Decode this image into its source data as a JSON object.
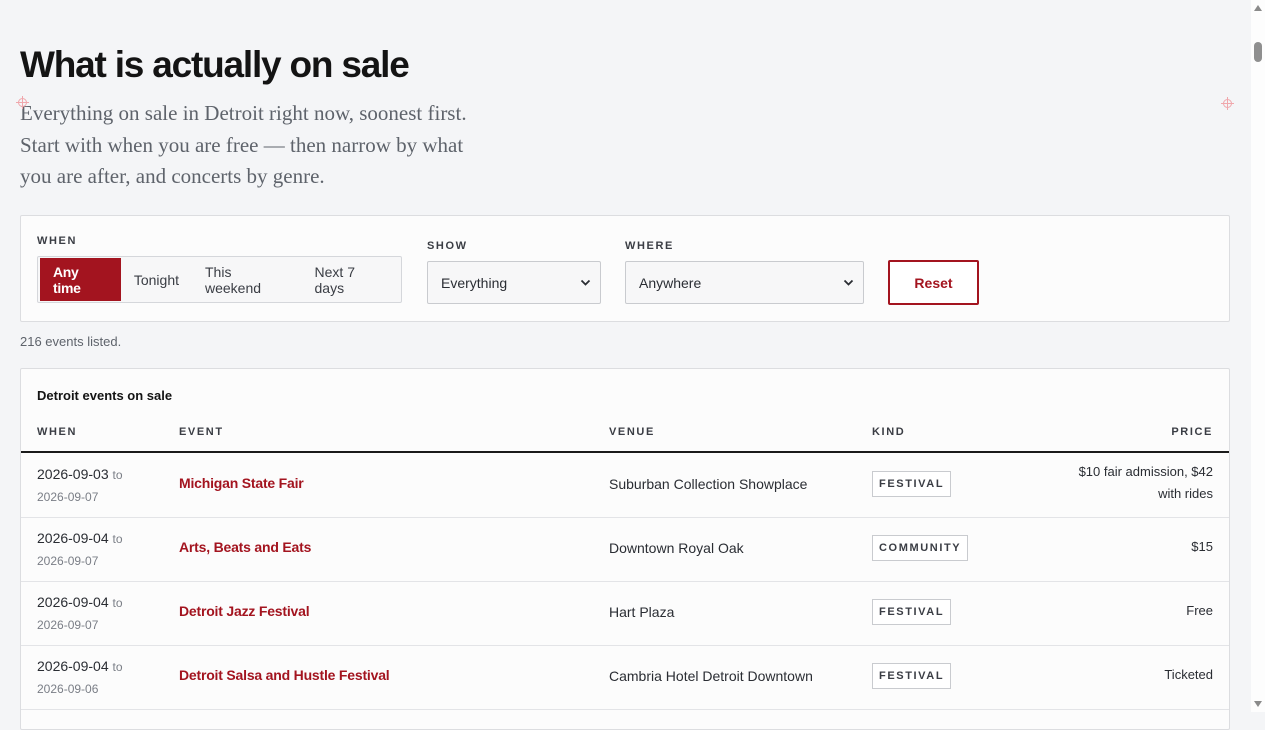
{
  "header": {
    "title": "What is actually on sale",
    "lede": "Everything on sale in Detroit right now, soonest first. Start with when you are free — then narrow by what you are after, and concerts by genre."
  },
  "filters": {
    "when_label": "WHEN",
    "when_options": [
      "Any time",
      "Tonight",
      "This weekend",
      "Next 7 days"
    ],
    "when_selected": "Any time",
    "show_label": "SHOW",
    "show_value": "Everything",
    "where_label": "WHERE",
    "where_value": "Anywhere",
    "reset_label": "Reset"
  },
  "count_text": "216 events listed.",
  "table": {
    "caption": "Detroit events on sale",
    "columns": [
      "WHEN",
      "EVENT",
      "VENUE",
      "KIND",
      "PRICE"
    ],
    "rows": [
      {
        "start": "2026-09-03",
        "to": "to",
        "end": "2026-09-07",
        "event": "Michigan State Fair",
        "venue": "Suburban Collection Showplace",
        "kind": "FESTIVAL",
        "price": "$10 fair admission, $42 with rides"
      },
      {
        "start": "2026-09-04",
        "to": "to",
        "end": "2026-09-07",
        "event": "Arts, Beats and Eats",
        "venue": "Downtown Royal Oak",
        "kind": "COMMUNITY",
        "price": "$15"
      },
      {
        "start": "2026-09-04",
        "to": "to",
        "end": "2026-09-07",
        "event": "Detroit Jazz Festival",
        "venue": "Hart Plaza",
        "kind": "FESTIVAL",
        "price": "Free"
      },
      {
        "start": "2026-09-04",
        "to": "to",
        "end": "2026-09-06",
        "event": "Detroit Salsa and Hustle Festival",
        "venue": "Cambria Hotel Detroit Downtown",
        "kind": "FESTIVAL",
        "price": "Ticketed"
      }
    ]
  },
  "colors": {
    "accent": "#a3141f",
    "background": "#f4f5f7"
  },
  "icons": [
    "chevron-down-icon",
    "crosshair-icon"
  ]
}
